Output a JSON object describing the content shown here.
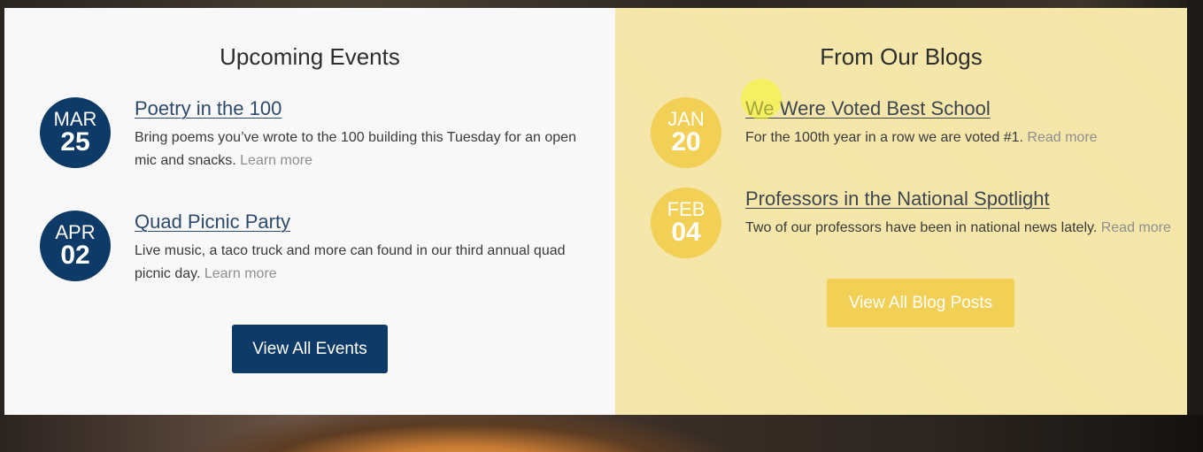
{
  "events": {
    "title": "Upcoming Events",
    "items": [
      {
        "month": "MAR",
        "day": "25",
        "title": "Poetry in the 100",
        "description": "Bring poems you’ve wrote to the 100 building this Tuesday for an open mic and snacks.",
        "link": "Learn more"
      },
      {
        "month": "APR",
        "day": "02",
        "title": "Quad Picnic Party",
        "description": "Live music, a taco truck and more can found in our third annual quad picnic day.",
        "link": "Learn more"
      }
    ],
    "button_label": "View All Events"
  },
  "blogs": {
    "title": "From Our Blogs",
    "items": [
      {
        "month": "JAN",
        "day": "20",
        "title": "We Were Voted Best School",
        "description": "For the 100th year in a row we are voted #1.",
        "link": "Read more"
      },
      {
        "month": "FEB",
        "day": "04",
        "title": "Professors in the National Spotlight",
        "description": "Two of our professors have been in national news lately.",
        "link": "Read more"
      }
    ],
    "button_label": "View All Blog Posts"
  },
  "colors": {
    "events_accent": "#0e3a68",
    "blogs_accent": "#f2cf55",
    "blogs_background": "#f4e5a4",
    "events_background": "#f8f8f8"
  }
}
